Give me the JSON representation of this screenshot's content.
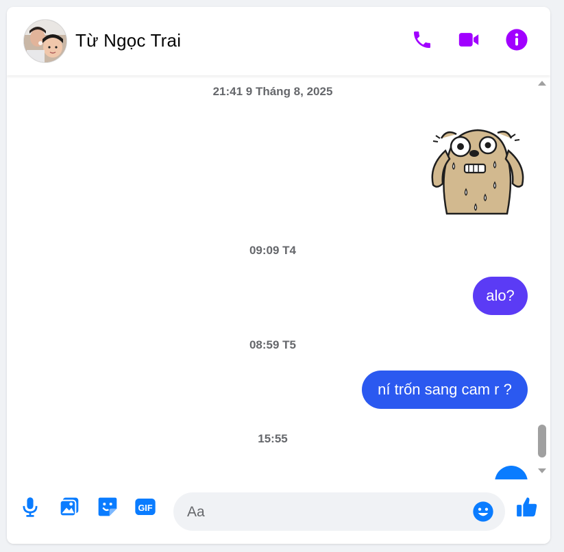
{
  "header": {
    "contact_name": "Từ Ngọc Trai",
    "icons": [
      "phone-icon",
      "video-camera-icon",
      "info-icon"
    ]
  },
  "messages": [
    {
      "type": "timestamp",
      "text": "21:41 9 Tháng 8, 2025"
    },
    {
      "type": "sticker",
      "sender": "me",
      "description": "sweating-bear-sticker"
    },
    {
      "type": "timestamp",
      "text": "09:09 T4"
    },
    {
      "type": "bubble",
      "sender": "me",
      "text": "alo?"
    },
    {
      "type": "timestamp",
      "text": "08:59 T5"
    },
    {
      "type": "bubble",
      "sender": "me",
      "text": "ní trốn sang cam r ?"
    },
    {
      "type": "timestamp",
      "text": "15:55"
    }
  ],
  "composer": {
    "placeholder": "Aa",
    "icons": [
      "microphone-icon",
      "image-icon",
      "sticker-icon",
      "gif-icon",
      "emoji-icon",
      "thumbs-up-icon"
    ],
    "gif_label": "GIF"
  },
  "colors": {
    "header_icon": "#a100ff",
    "composer_icon": "#0a7cff",
    "bubble_1": "#5b3bf5",
    "bubble_2": "#2b59f0",
    "bubble_3": "#0a7cff"
  }
}
